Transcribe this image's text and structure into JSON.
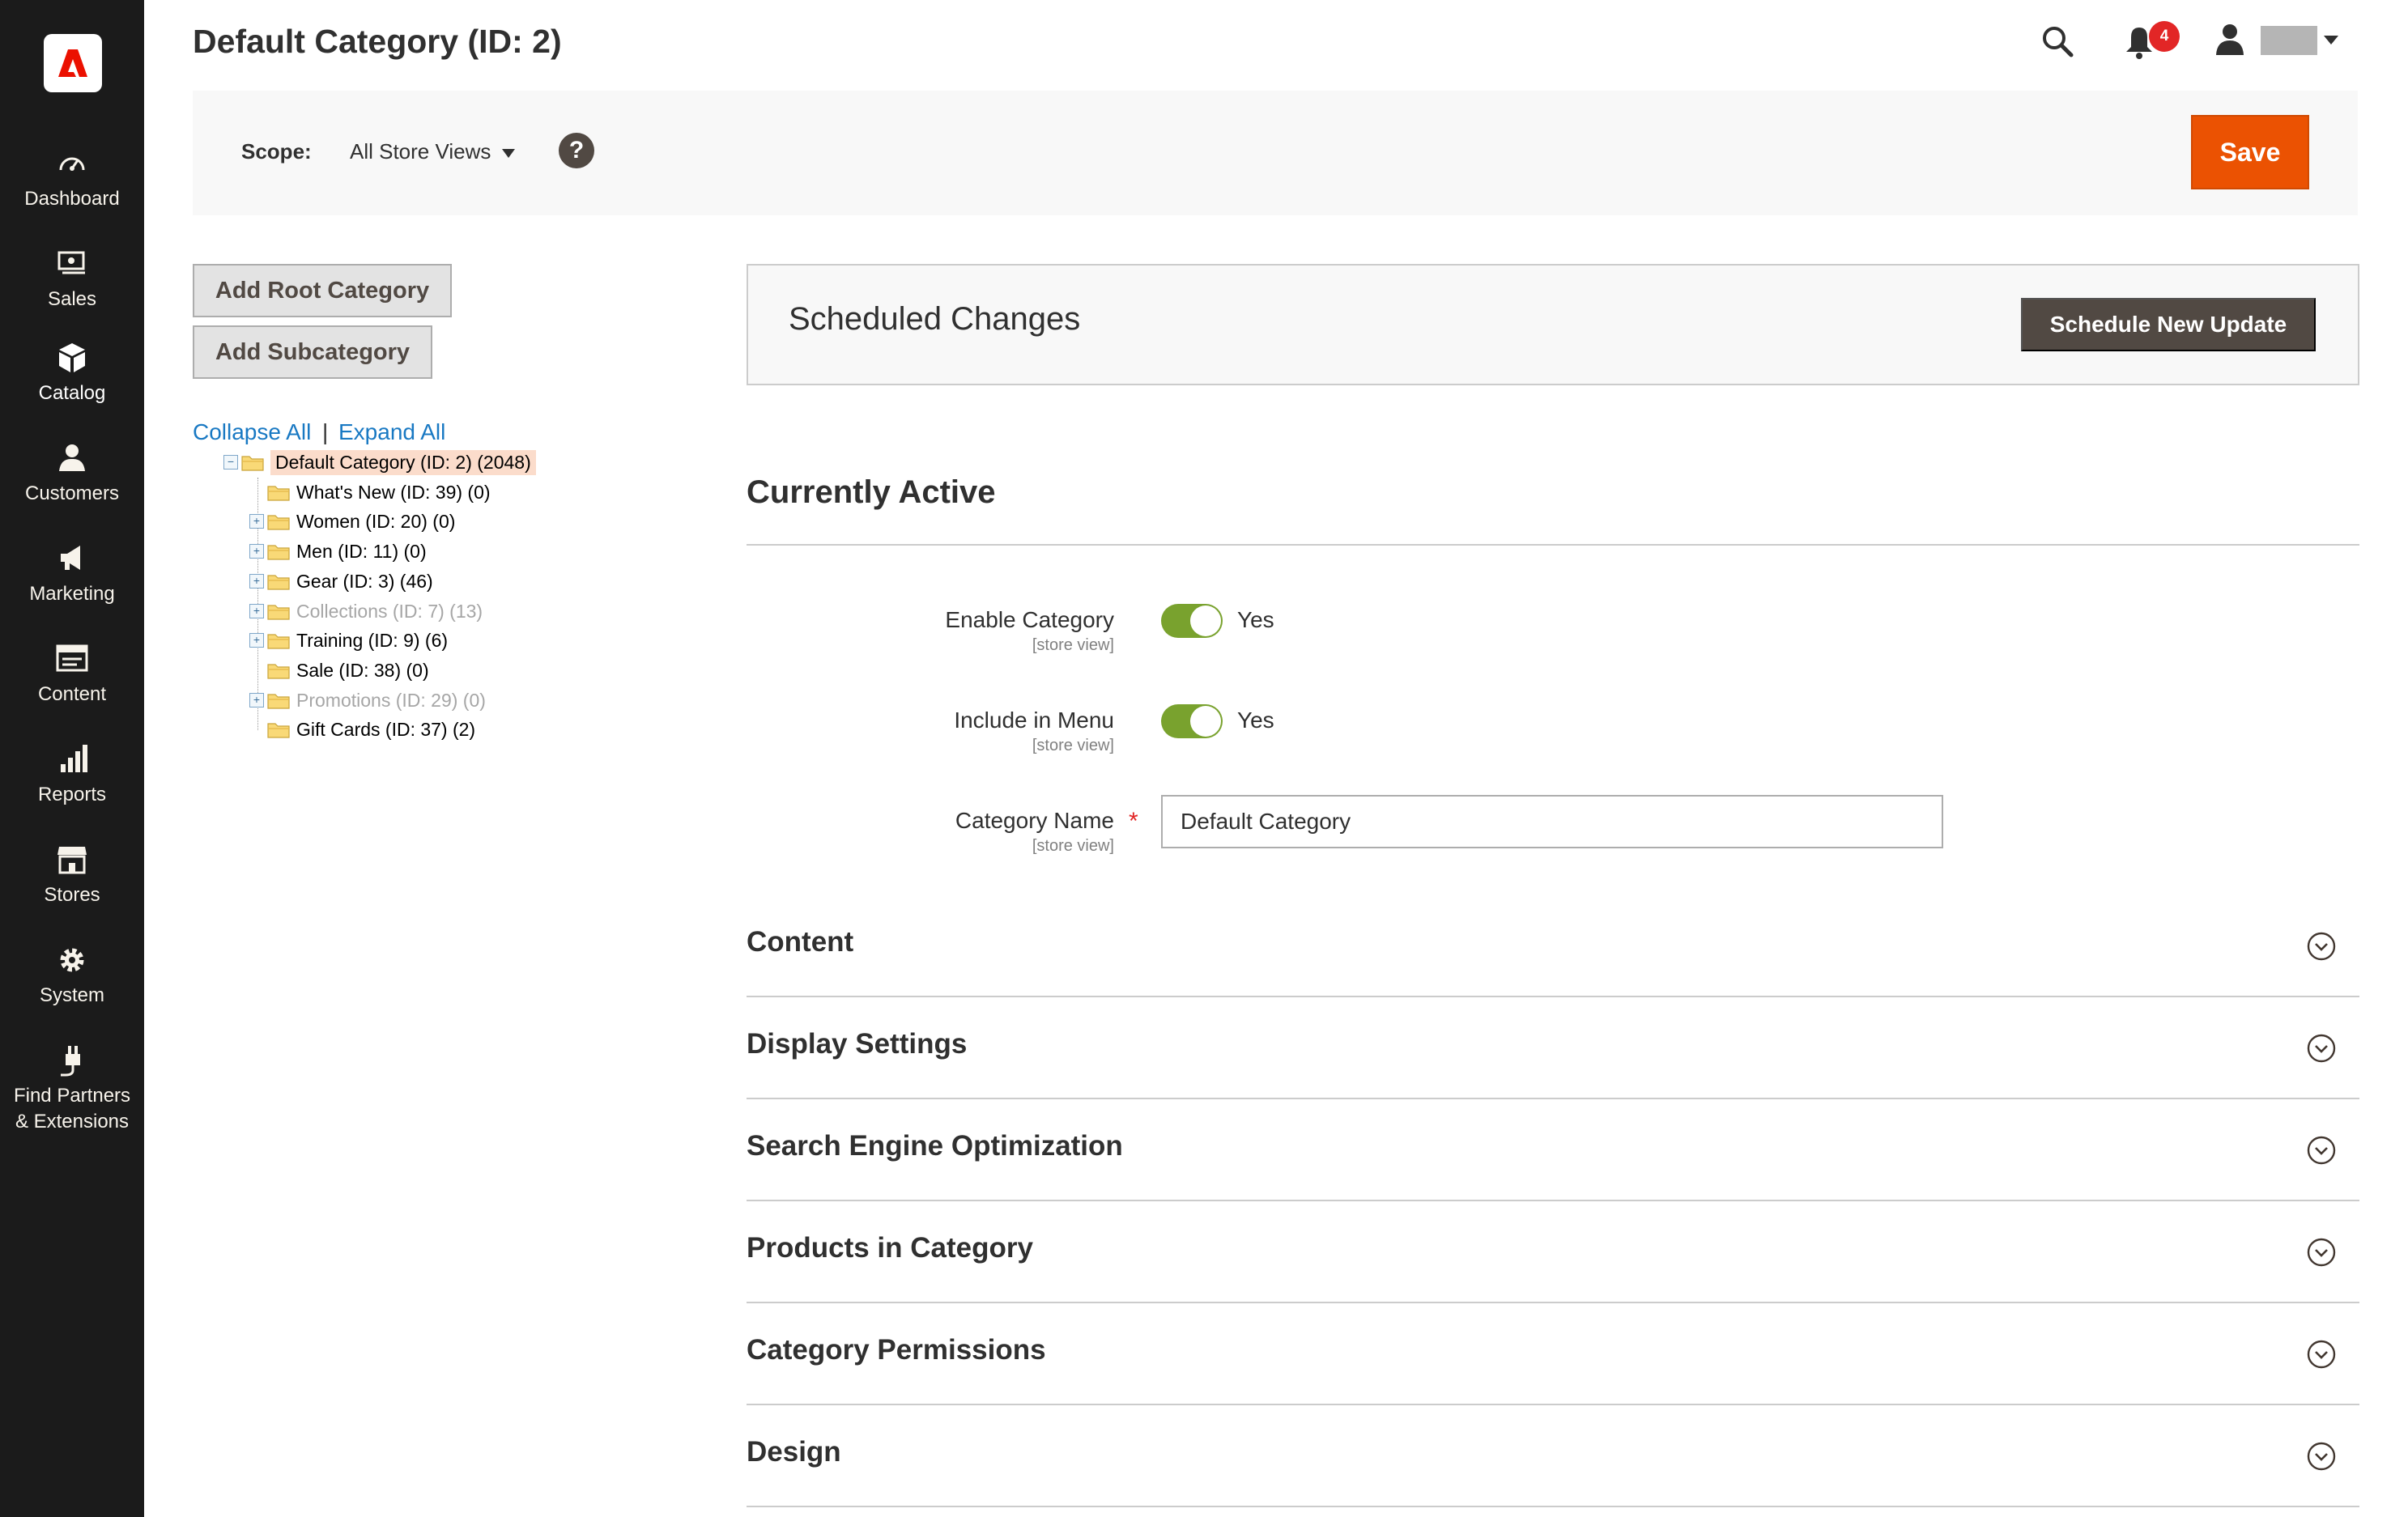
{
  "sidebar": {
    "logo": "adobe-logo",
    "items": [
      {
        "label": "Dashboard",
        "icon": "dashboard-icon"
      },
      {
        "label": "Sales",
        "icon": "sales-icon"
      },
      {
        "label": "Catalog",
        "icon": "catalog-icon"
      },
      {
        "label": "Customers",
        "icon": "customers-icon"
      },
      {
        "label": "Marketing",
        "icon": "marketing-icon"
      },
      {
        "label": "Content",
        "icon": "content-icon"
      },
      {
        "label": "Reports",
        "icon": "reports-icon"
      },
      {
        "label": "Stores",
        "icon": "stores-icon"
      },
      {
        "label": "System",
        "icon": "gear-icon"
      },
      {
        "label": "Find Partners",
        "label2": "& Extensions",
        "icon": "plug-icon"
      }
    ]
  },
  "header": {
    "title": "Default Category (ID: 2)",
    "notification_count": "4"
  },
  "scope_bar": {
    "label": "Scope:",
    "value": "All Store Views",
    "help": "?",
    "save_label": "Save"
  },
  "left": {
    "add_root_label": "Add Root Category",
    "add_sub_label": "Add Subcategory",
    "collapse_all": "Collapse All",
    "separator": "|",
    "expand_all": "Expand All",
    "tree": [
      {
        "text": "Default Category (ID: 2) (2048)",
        "level": 0,
        "toggle": "minus",
        "selected": true,
        "disabled": false
      },
      {
        "text": "What's New (ID: 39) (0)",
        "level": 1,
        "toggle": "",
        "selected": false,
        "disabled": false
      },
      {
        "text": "Women (ID: 20) (0)",
        "level": 1,
        "toggle": "plus",
        "selected": false,
        "disabled": false
      },
      {
        "text": "Men (ID: 11) (0)",
        "level": 1,
        "toggle": "plus",
        "selected": false,
        "disabled": false
      },
      {
        "text": "Gear (ID: 3) (46)",
        "level": 1,
        "toggle": "plus",
        "selected": false,
        "disabled": false
      },
      {
        "text": "Collections (ID: 7) (13)",
        "level": 1,
        "toggle": "plus",
        "selected": false,
        "disabled": true
      },
      {
        "text": "Training (ID: 9) (6)",
        "level": 1,
        "toggle": "plus",
        "selected": false,
        "disabled": false
      },
      {
        "text": "Sale (ID: 38) (0)",
        "level": 1,
        "toggle": "",
        "selected": false,
        "disabled": false
      },
      {
        "text": "Promotions (ID: 29) (0)",
        "level": 1,
        "toggle": "plus",
        "selected": false,
        "disabled": true
      },
      {
        "text": "Gift Cards (ID: 37) (2)",
        "level": 1,
        "toggle": "",
        "selected": false,
        "disabled": false
      }
    ]
  },
  "scheduled": {
    "title": "Scheduled Changes",
    "button_label": "Schedule New Update"
  },
  "active": {
    "title": "Currently Active",
    "enable_label": "Enable Category",
    "enable_scope": "[store view]",
    "enable_value": "Yes",
    "menu_label": "Include in Menu",
    "menu_scope": "[store view]",
    "menu_value": "Yes",
    "name_label": "Category Name",
    "name_scope": "[store view]",
    "name_required": "*",
    "name_value": "Default Category"
  },
  "sections": [
    {
      "title": "Content"
    },
    {
      "title": "Display Settings"
    },
    {
      "title": "Search Engine Optimization"
    },
    {
      "title": "Products in Category"
    },
    {
      "title": "Category Permissions"
    },
    {
      "title": "Design"
    }
  ],
  "colors": {
    "sidebar_bg": "#1b1b1b",
    "accent_save": "#eb5202",
    "toggle_on": "#79a22e",
    "link": "#1979c3",
    "badge": "#e22626"
  }
}
